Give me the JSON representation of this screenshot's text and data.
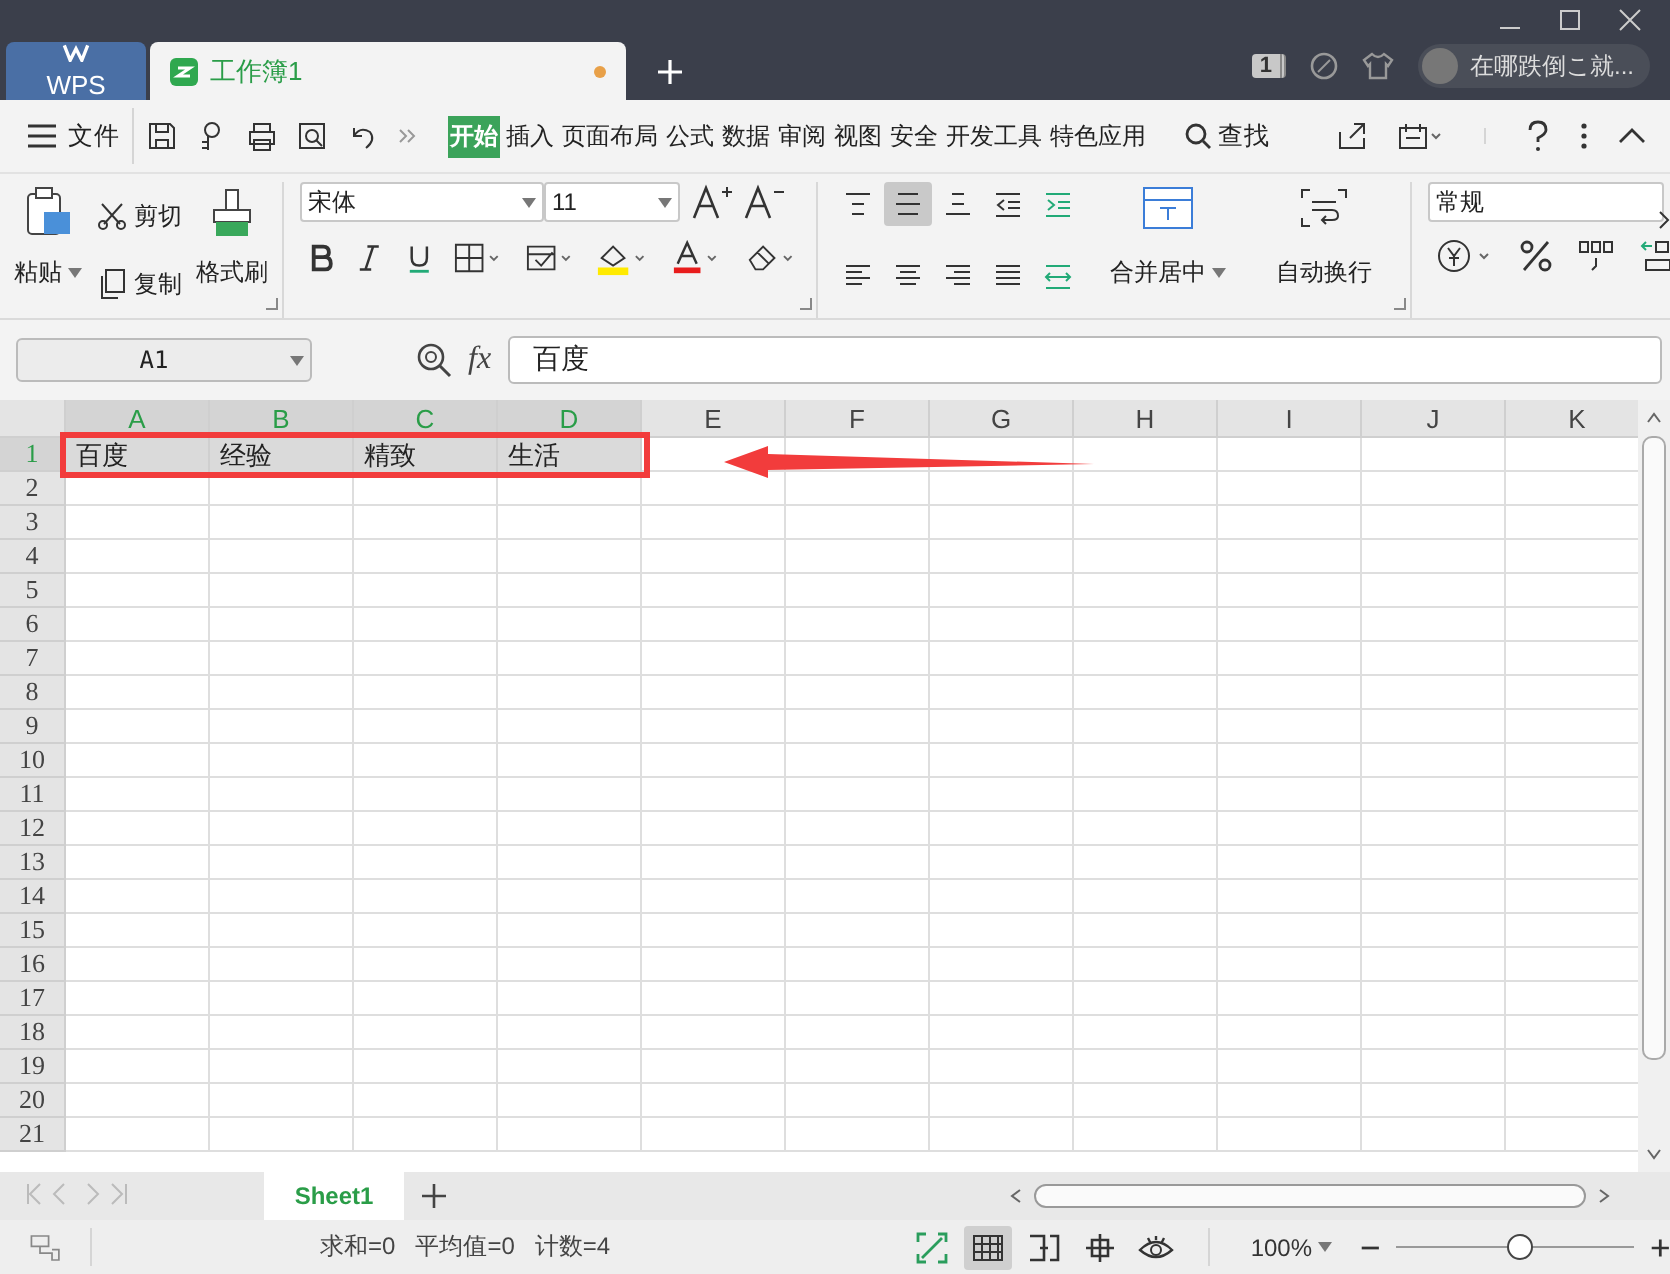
{
  "title_bar": {
    "tabs": [
      {
        "label": "WPS",
        "kind": "app",
        "selected": false,
        "unsaved": false
      },
      {
        "label": "工作簿1",
        "kind": "sheet",
        "selected": true,
        "unsaved": true
      }
    ],
    "badge": "1",
    "user": "在哪跌倒こ就..."
  },
  "menu": {
    "file": "文件",
    "tabs": [
      {
        "label": "开始",
        "selected": true
      },
      {
        "label": "插入",
        "selected": false
      },
      {
        "label": "页面布局",
        "selected": false
      },
      {
        "label": "公式",
        "selected": false
      },
      {
        "label": "数据",
        "selected": false
      },
      {
        "label": "审阅",
        "selected": false
      },
      {
        "label": "视图",
        "selected": false
      },
      {
        "label": "安全",
        "selected": false
      },
      {
        "label": "开发工具",
        "selected": false
      },
      {
        "label": "特色应用",
        "selected": false
      }
    ],
    "search": "查找"
  },
  "ribbon": {
    "paste": "粘贴",
    "cut": "剪切",
    "copy": "复制",
    "format_painter": "格式刷",
    "font": "宋体",
    "size": "11",
    "merge": "合并居中",
    "wrap": "自动换行",
    "number_format": "常规",
    "align_buttons": [
      {
        "kind": "top",
        "selected": false
      },
      {
        "kind": "middle",
        "selected": true
      },
      {
        "kind": "bottom",
        "selected": false
      },
      {
        "kind": "outdent",
        "selected": false
      },
      {
        "kind": "indent",
        "selected": false
      },
      {
        "kind": "left",
        "selected": false
      },
      {
        "kind": "center",
        "selected": false
      },
      {
        "kind": "right",
        "selected": false
      },
      {
        "kind": "justify",
        "selected": false
      },
      {
        "kind": "distribute",
        "selected": false
      }
    ]
  },
  "formula_bar": {
    "cell": "A1",
    "fx": "fx",
    "value": "百度"
  },
  "sheet": {
    "columns": [
      {
        "label": "A",
        "selected": true
      },
      {
        "label": "B",
        "selected": true
      },
      {
        "label": "C",
        "selected": true
      },
      {
        "label": "D",
        "selected": true
      },
      {
        "label": "E",
        "selected": false
      },
      {
        "label": "F",
        "selected": false
      },
      {
        "label": "G",
        "selected": false
      },
      {
        "label": "H",
        "selected": false
      },
      {
        "label": "I",
        "selected": false
      },
      {
        "label": "J",
        "selected": false
      },
      {
        "label": "K",
        "selected": false
      }
    ],
    "rows": [
      {
        "label": "1",
        "selected": true,
        "cells": [
          "百度",
          "经验",
          "精致",
          "生活"
        ]
      },
      {
        "label": "2",
        "selected": false,
        "cells": []
      },
      {
        "label": "3",
        "selected": false,
        "cells": []
      },
      {
        "label": "4",
        "selected": false,
        "cells": []
      },
      {
        "label": "5",
        "selected": false,
        "cells": []
      },
      {
        "label": "6",
        "selected": false,
        "cells": []
      },
      {
        "label": "7",
        "selected": false,
        "cells": []
      },
      {
        "label": "8",
        "selected": false,
        "cells": []
      },
      {
        "label": "9",
        "selected": false,
        "cells": []
      },
      {
        "label": "10",
        "selected": false,
        "cells": []
      },
      {
        "label": "11",
        "selected": false,
        "cells": []
      },
      {
        "label": "12",
        "selected": false,
        "cells": []
      },
      {
        "label": "13",
        "selected": false,
        "cells": []
      },
      {
        "label": "14",
        "selected": false,
        "cells": []
      },
      {
        "label": "15",
        "selected": false,
        "cells": []
      },
      {
        "label": "16",
        "selected": false,
        "cells": []
      },
      {
        "label": "17",
        "selected": false,
        "cells": []
      },
      {
        "label": "18",
        "selected": false,
        "cells": []
      },
      {
        "label": "19",
        "selected": false,
        "cells": []
      },
      {
        "label": "20",
        "selected": false,
        "cells": []
      },
      {
        "label": "21",
        "selected": false,
        "cells": []
      }
    ]
  },
  "sheet_tabs": [
    {
      "label": "Sheet1",
      "selected": true
    }
  ],
  "status_bar": {
    "sum": "求和=0",
    "average": "平均值=0",
    "count": "计数=4",
    "view_buttons": [
      {
        "kind": "fullscreen",
        "selected": false
      },
      {
        "kind": "normal",
        "selected": true
      },
      {
        "kind": "pagebreak",
        "selected": false
      },
      {
        "kind": "reading",
        "selected": false
      },
      {
        "kind": "eye",
        "selected": false
      }
    ],
    "zoom": "100%",
    "zoom_slider": {
      "level": 0.52
    }
  }
}
